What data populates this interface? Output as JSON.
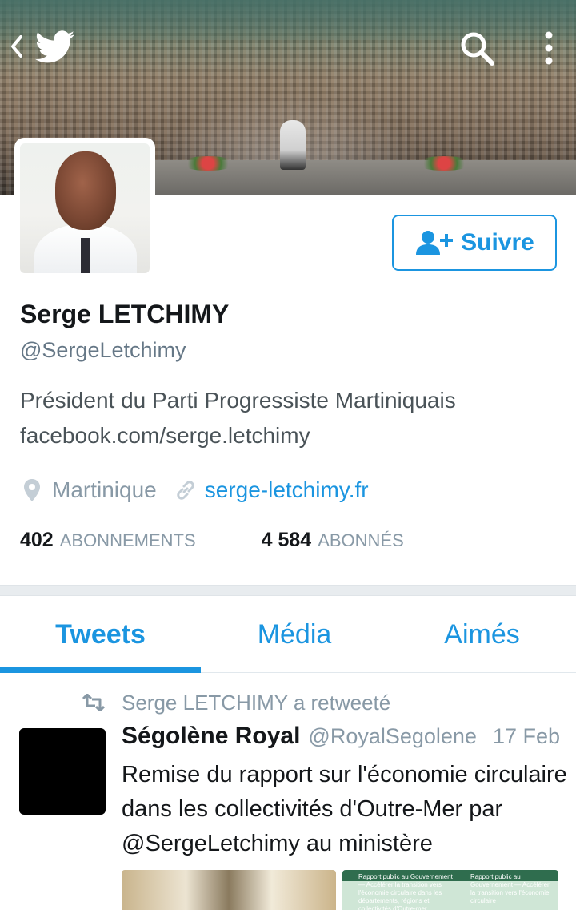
{
  "profile": {
    "name": "Serge LETCHIMY",
    "handle": "@SergeLetchimy",
    "bio_line1": "Président du Parti Progressiste Martiniquais",
    "bio_line2": "facebook.com/serge.letchimy",
    "location": "Martinique",
    "website": "serge-letchimy.fr",
    "following_count": "402",
    "following_label": "ABONNEMENTS",
    "followers_count": "4 584",
    "followers_label": "ABONNÉS"
  },
  "header": {
    "icons": [
      "back-icon",
      "twitter-bird-icon",
      "search-icon",
      "overflow-menu-icon"
    ]
  },
  "follow_button": {
    "label": "Suivre",
    "icon": "person-plus-icon"
  },
  "tabs": [
    {
      "label": "Tweets",
      "active": true
    },
    {
      "label": "Média",
      "active": false
    },
    {
      "label": "Aimés",
      "active": false
    }
  ],
  "tweet": {
    "retweet_context": "Serge LETCHIMY a retweeté",
    "author": "Ségolène Royal",
    "handle": "@RoyalSegolene",
    "date": "17 Feb",
    "text": "Remise du rapport sur l'économie circulaire dans les collectivités d'Outre-Mer par @SergeLetchimy au ministère",
    "media_2_text_a": "Rapport public au Gouvernement — Accélérer la transition vers l'économie circulaire dans les départements, régions et collectivités d'Outre-mer",
    "media_2_text_b": "Rapport public au Gouvernement — Accélérer la transition vers l'économie circulaire"
  },
  "colors": {
    "accent": "#1b95e0",
    "text_primary": "#14171a",
    "text_secondary": "#8899a6"
  }
}
